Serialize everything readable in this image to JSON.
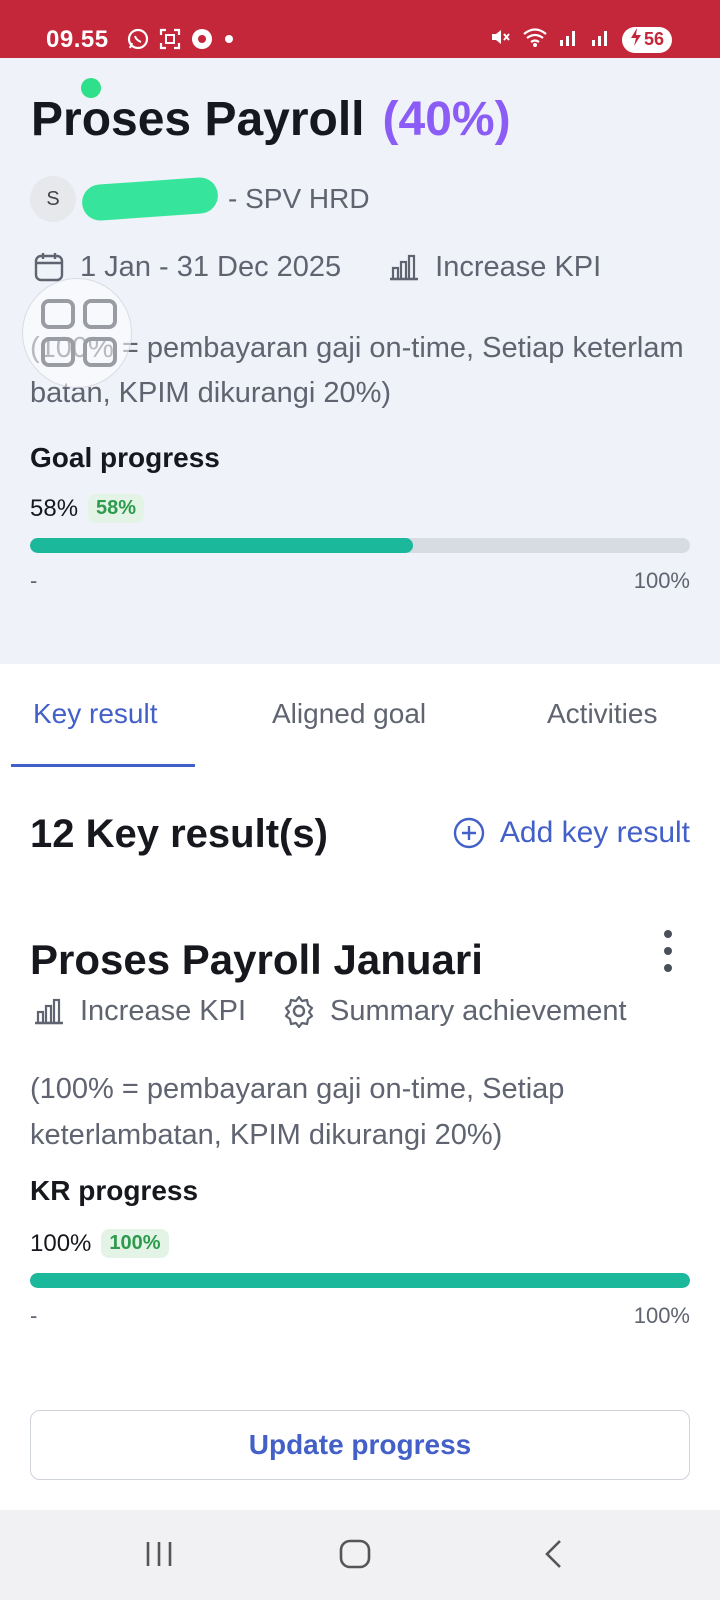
{
  "status_bar": {
    "time": "09.55",
    "battery": "56",
    "icons": [
      "whatsapp-icon",
      "screenshot-icon",
      "opera-icon",
      "dot-icon",
      "mute-icon",
      "wifi-icon",
      "signal-icon",
      "signal-icon",
      "battery-charging-icon"
    ]
  },
  "goal": {
    "title": "Proses Payroll",
    "percent_label": "(40%)",
    "avatar_initial": "S",
    "owner_role": "- SPV HRD",
    "date_range": "1 Jan - 31 Dec 2025",
    "kpi_type": "Increase KPI",
    "description": "(100% = pembayaran gaji on-time, Setiap keterlambatan, KPIM dikurangi 20%)",
    "progress_label": "Goal progress",
    "progress_value": "58%",
    "progress_badge": "58%",
    "progress_fraction": 0.58,
    "range_min": "-",
    "range_max": "100%"
  },
  "tabs": [
    {
      "label": "Key result",
      "active": true
    },
    {
      "label": "Aligned goal",
      "active": false
    },
    {
      "label": "Activities",
      "active": false
    }
  ],
  "key_results": {
    "count_label": "12 Key result(s)",
    "add_label": "Add key result",
    "item": {
      "title": "Proses Payroll Januari",
      "kpi_type": "Increase KPI",
      "summary_label": "Summary achievement",
      "description": "(100% = pembayaran gaji on-time, Setiap keterlambatan, KPIM dikurangi 20%)",
      "progress_label": "KR progress",
      "progress_value": "100%",
      "progress_badge": "100%",
      "progress_fraction": 1.0,
      "range_min": "-",
      "range_max": "100%",
      "update_label": "Update progress"
    }
  },
  "colors": {
    "status_bar": "#c4273a",
    "accent": "#4360c9",
    "purple": "#8b5cf6",
    "progress": "#1bb89c",
    "badge_bg": "#e3f4e7",
    "badge_text": "#2e9a4d"
  },
  "nav": [
    "recents-icon",
    "home-icon",
    "back-icon"
  ]
}
